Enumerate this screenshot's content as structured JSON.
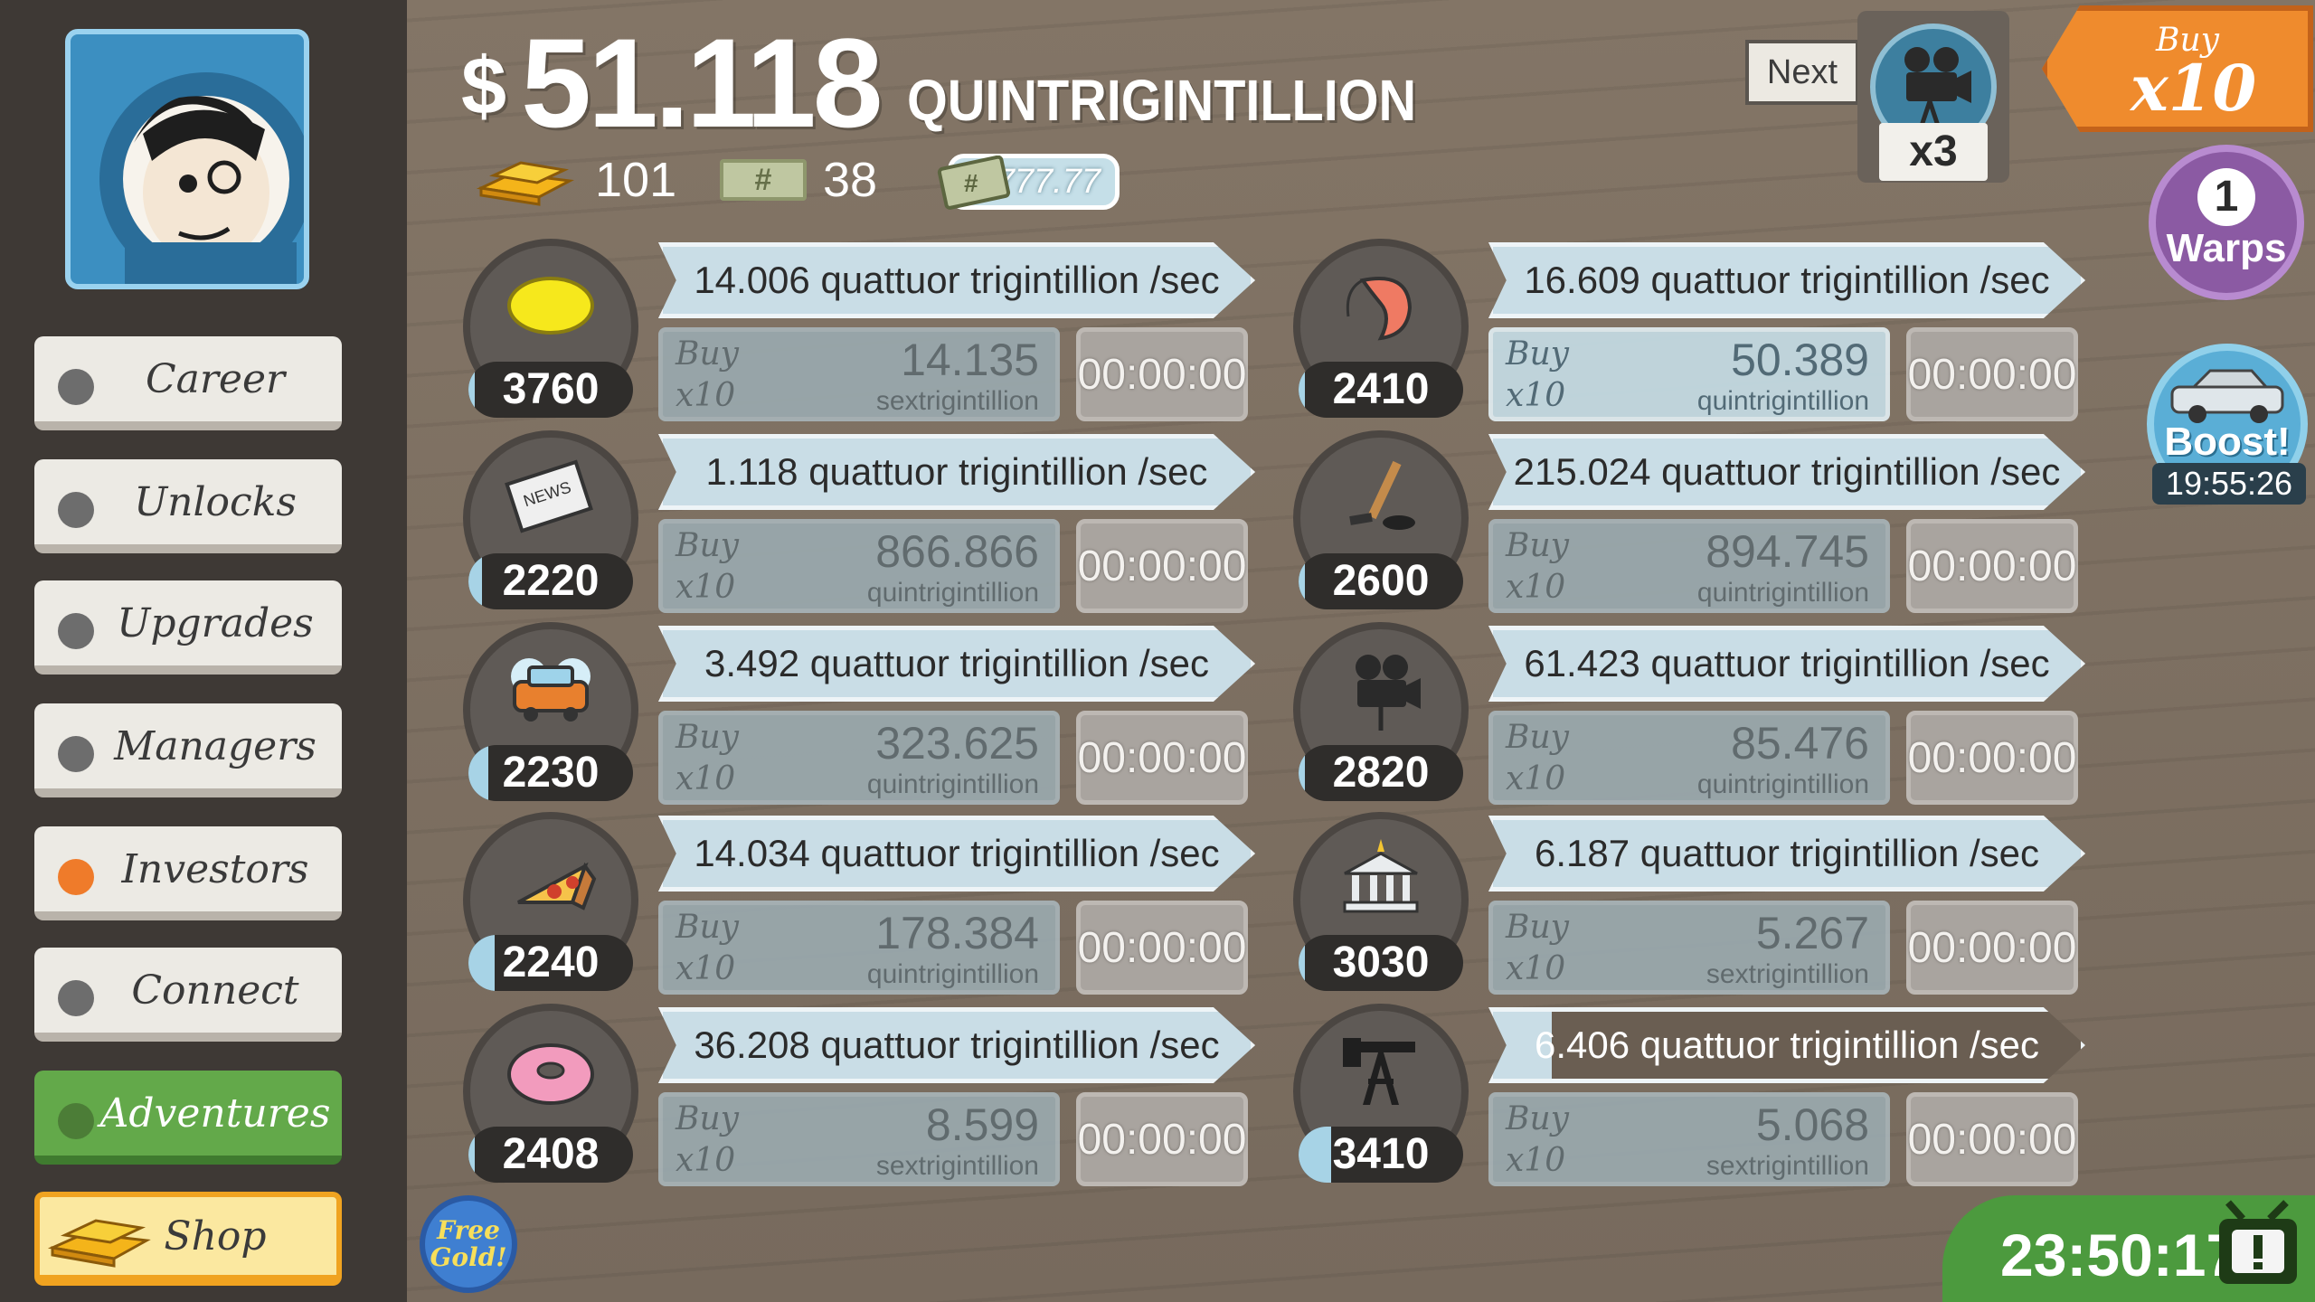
{
  "header": {
    "currency_symbol": "$",
    "cash_amount": "51.118",
    "cash_unit": "QUINTRIGINTILLION",
    "gold_count": "101",
    "megaticket_count": "38",
    "multiplier": "x777.77"
  },
  "sidebar": {
    "items": [
      {
        "label": "Career"
      },
      {
        "label": "Unlocks"
      },
      {
        "label": "Upgrades"
      },
      {
        "label": "Managers"
      },
      {
        "label": "Investors"
      },
      {
        "label": "Connect"
      },
      {
        "label": "Adventures"
      },
      {
        "label": "Shop"
      }
    ]
  },
  "top_right": {
    "next_label": "Next",
    "manager_multiplier": "x3",
    "buy_top": "Buy",
    "buy_bottom": "x10",
    "warps_count": "1",
    "warps_label": "Warps",
    "boost_label": "Boost!",
    "boost_timer": "19:55:26"
  },
  "businesses": [
    {
      "icon": "lemon-icon",
      "count": "3760",
      "progress": 0,
      "rate": "14.006 quattuor trigintillion /sec",
      "buy": "Buy",
      "multiplier": "x10",
      "cost": "14.135",
      "cost_unit": "sextrigintillion",
      "timer": "00:00:00"
    },
    {
      "icon": "newspaper-icon",
      "count": "2220",
      "progress": 0.2,
      "rate": "1.118 quattuor trigintillion /sec",
      "buy": "Buy",
      "multiplier": "x10",
      "cost": "866.866",
      "cost_unit": "quintrigintillion",
      "timer": "00:00:00"
    },
    {
      "icon": "car-wash-icon",
      "count": "2230",
      "progress": 0.3,
      "rate": "3.492 quattuor trigintillion /sec",
      "buy": "Buy",
      "multiplier": "x10",
      "cost": "323.625",
      "cost_unit": "quintrigintillion",
      "timer": "00:00:00"
    },
    {
      "icon": "pizza-icon",
      "count": "2240",
      "progress": 0.4,
      "rate": "14.034 quattuor trigintillion /sec",
      "buy": "Buy",
      "multiplier": "x10",
      "cost": "178.384",
      "cost_unit": "quintrigintillion",
      "timer": "00:00:00"
    },
    {
      "icon": "donut-icon",
      "count": "2408",
      "progress": 0,
      "rate": "36.208 quattuor trigintillion /sec",
      "buy": "Buy",
      "multiplier": "x10",
      "cost": "8.599",
      "cost_unit": "sextrigintillion",
      "timer": "00:00:00"
    },
    {
      "icon": "shrimp-icon",
      "count": "2410",
      "progress": 0.1,
      "rate": "16.609 quattuor trigintillion /sec",
      "buy": "Buy",
      "multiplier": "x10",
      "cost": "50.389",
      "cost_unit": "quintrigintillion",
      "timer": "00:00:00"
    },
    {
      "icon": "hockey-icon",
      "count": "2600",
      "progress": 0,
      "rate": "215.024 quattuor trigintillion /sec",
      "buy": "Buy",
      "multiplier": "x10",
      "cost": "894.745",
      "cost_unit": "quintrigintillion",
      "timer": "00:00:00"
    },
    {
      "icon": "movie-camera-icon",
      "count": "2820",
      "progress": 0.1,
      "rate": "61.423 quattuor trigintillion /sec",
      "buy": "Buy",
      "multiplier": "x10",
      "cost": "85.476",
      "cost_unit": "quintrigintillion",
      "timer": "00:00:00"
    },
    {
      "icon": "bank-icon",
      "count": "3030",
      "progress": 0.1,
      "rate": "6.187 quattuor trigintillion /sec",
      "buy": "Buy",
      "multiplier": "x10",
      "cost": "5.267",
      "cost_unit": "sextrigintillion",
      "timer": "00:00:00"
    },
    {
      "icon": "oil-rig-icon",
      "count": "3410",
      "progress": 0.5,
      "rate": "6.406 quattuor trigintillion /sec",
      "buy": "Buy",
      "multiplier": "x10",
      "cost": "5.068",
      "cost_unit": "sextrigintillion",
      "timer": "00:00:00"
    }
  ],
  "footer": {
    "free_gold_top": "Free",
    "free_gold_bottom": "Gold!",
    "session_timer": "23:50:17"
  },
  "colors": {
    "accent_orange": "#ef8b2d",
    "cash_green": "#63a94a",
    "rate_blue": "#c9dde6",
    "warps_purple": "#8b5aa3"
  }
}
